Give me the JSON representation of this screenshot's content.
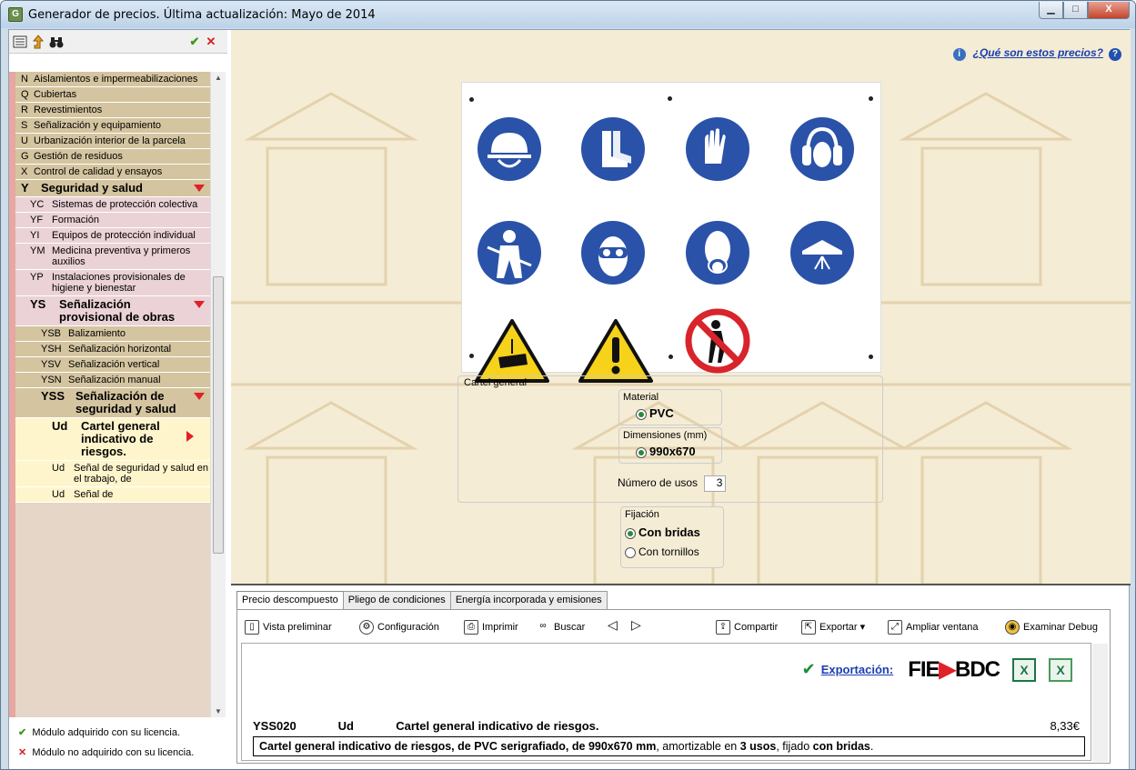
{
  "window": {
    "title": "Generador de precios. Última actualización: Mayo de 2014",
    "app_icon_text": "G",
    "min_glyph": "▁",
    "max_glyph": "□",
    "close_glyph": "X"
  },
  "toolbar_left": {
    "check": "✔",
    "cross": "✕"
  },
  "tree": [
    {
      "code": "N",
      "label": "Aislamientos e impermeabilizaciones",
      "style": "tan",
      "indent": 0
    },
    {
      "code": "Q",
      "label": "Cubiertas",
      "style": "tan",
      "indent": 0
    },
    {
      "code": "R",
      "label": "Revestimientos",
      "style": "tan",
      "indent": 0
    },
    {
      "code": "S",
      "label": "Señalización y equipamiento",
      "style": "tan",
      "indent": 0
    },
    {
      "code": "U",
      "label": "Urbanización interior de la parcela",
      "style": "tan",
      "indent": 0
    },
    {
      "code": "G",
      "label": "Gestión de residuos",
      "style": "tan",
      "indent": 0
    },
    {
      "code": "X",
      "label": "Control de calidad y ensayos",
      "style": "tan",
      "indent": 0
    },
    {
      "code": "Y",
      "label": "Seguridad y salud",
      "style": "tan",
      "indent": 0,
      "bold": true,
      "expanded": true
    },
    {
      "code": "YC",
      "label": "Sistemas de protección colectiva",
      "style": "pink",
      "indent": 1
    },
    {
      "code": "YF",
      "label": "Formación",
      "style": "pink",
      "indent": 1
    },
    {
      "code": "YI",
      "label": "Equipos de protección individual",
      "style": "pink",
      "indent": 1
    },
    {
      "code": "YM",
      "label": "Medicina preventiva y primeros auxilios",
      "style": "pink",
      "indent": 1
    },
    {
      "code": "YP",
      "label": "Instalaciones provisionales de higiene y bienestar",
      "style": "pink",
      "indent": 1
    },
    {
      "code": "YS",
      "label": "Señalización provisional de obras",
      "style": "pink",
      "indent": 1,
      "bold": true,
      "expanded": true
    },
    {
      "code": "YSB",
      "label": "Balizamiento",
      "style": "tan",
      "indent": 2
    },
    {
      "code": "YSH",
      "label": "Señalización horizontal",
      "style": "tan",
      "indent": 2
    },
    {
      "code": "YSV",
      "label": "Señalización vertical",
      "style": "tan",
      "indent": 2
    },
    {
      "code": "YSN",
      "label": "Señalización manual",
      "style": "tan",
      "indent": 2
    },
    {
      "code": "YSS",
      "label": "Señalización de seguridad y salud",
      "style": "tan",
      "indent": 2,
      "bold": true,
      "expanded": true
    },
    {
      "code": "Ud",
      "label": "Cartel general indicativo de riesgos.",
      "style": "sel",
      "indent": 3,
      "bold": true,
      "selected": true
    },
    {
      "code": "Ud",
      "label": "Señal de seguridad y salud en el trabajo, de",
      "style": "sel",
      "indent": 3
    },
    {
      "code": "Ud",
      "label": "Señal de",
      "style": "sel",
      "indent": 3
    }
  ],
  "legend": {
    "acquired": "Módulo adquirido con su licencia.",
    "not_acquired": "Módulo no adquirido con su licencia.",
    "acquired_icon": "✔",
    "not_acquired_icon": "✕"
  },
  "main": {
    "help_link": "¿Qué son estos precios?",
    "info_icon": "i",
    "help_icon": "?"
  },
  "config": {
    "title": "Cartel general",
    "material_label": "Material",
    "material_value": "PVC",
    "dimensions_label": "Dimensiones (mm)",
    "dimensions_value": "990x670",
    "uses_label": "Número de usos",
    "uses_value": "3",
    "fixing_label": "Fijación",
    "fixing_options": [
      "Con bridas",
      "Con tornillos"
    ],
    "fixing_selected": "Con bridas"
  },
  "tabs": [
    "Precio descompuesto",
    "Pliego de condiciones",
    "Energía incorporada y emisiones"
  ],
  "toolbar": {
    "preview": "Vista preliminar",
    "config": "Configuración",
    "print": "Imprimir",
    "search": "Buscar",
    "prev": "◁",
    "next": "▷",
    "share": "Compartir",
    "export": "Exportar",
    "expand": "Ampliar ventana",
    "debug": "Examinar Debug"
  },
  "doc": {
    "export_label": "Exportación:",
    "fie_text": "FIE",
    "bdc_text": "BDC",
    "xl_text": "X",
    "code": "YSS020",
    "unit": "Ud",
    "name": "Cartel general indicativo de riesgos.",
    "price": "8,33€",
    "desc_1": "Cartel general indicativo de riesgos, de ",
    "desc_2": "PVC",
    "desc_3": " serigrafiado, de ",
    "desc_4": "990x670 mm",
    "desc_5": ", amortizable en ",
    "desc_6": "3 usos",
    "desc_7": ", fijado ",
    "desc_8": "con bridas",
    "desc_9": "."
  },
  "colors": {
    "mandatory_blue": "#2a52a8",
    "warning_yellow": "#f6d21b",
    "prohibition_red": "#d8242a",
    "tree_tan": "#d4c5a0",
    "tree_pink": "#ead2d6"
  }
}
